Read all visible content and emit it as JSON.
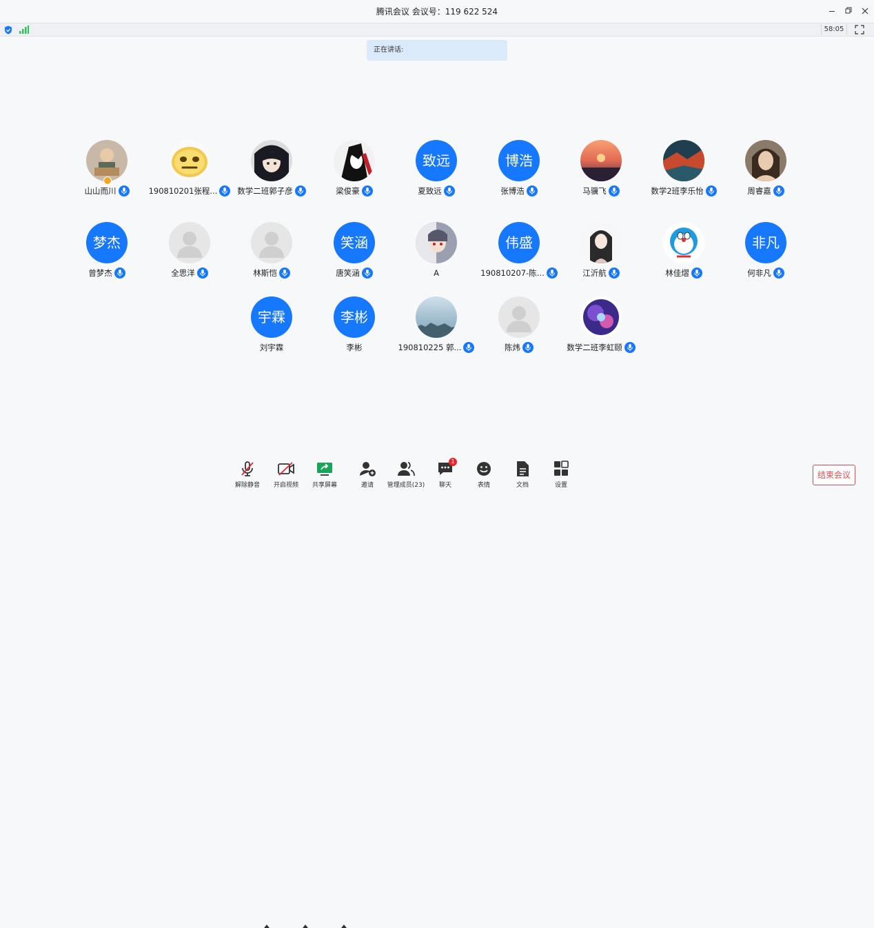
{
  "window": {
    "title": "腾讯会议 会议号：119 622 524",
    "controls": [
      "minimize-icon",
      "restore-icon",
      "close-icon"
    ]
  },
  "statusbar": {
    "timer": "58:05",
    "icons": [
      "shield-icon",
      "signal-icon",
      "fullscreen-icon"
    ]
  },
  "speaking": {
    "label": "正在讲话:"
  },
  "participants": [
    {
      "name": "山山而川",
      "type": "photo",
      "host": true
    },
    {
      "name": "190810201张程...",
      "type": "emoji"
    },
    {
      "name": "数学二班郭子彦",
      "type": "anime"
    },
    {
      "name": "梁俊豪",
      "type": "anime-dark"
    },
    {
      "name": "夏致远",
      "type": "text",
      "initials": "致远"
    },
    {
      "name": "张博浩",
      "type": "text",
      "initials": "博浩"
    },
    {
      "name": "马骥飞",
      "type": "sunset"
    },
    {
      "name": "数学2班李乐怡",
      "type": "landscape"
    },
    {
      "name": "周睿嘉",
      "type": "portrait"
    },
    {
      "name": "曾梦杰",
      "type": "text",
      "initials": "梦杰"
    },
    {
      "name": "全思洋",
      "type": "default"
    },
    {
      "name": "林斯恺",
      "type": "default"
    },
    {
      "name": "唐笑涵",
      "type": "text",
      "initials": "笑涵"
    },
    {
      "name": "A",
      "type": "anime-mix",
      "no_mic": true
    },
    {
      "name": "190810207-陈...",
      "type": "text",
      "initials": "伟盛"
    },
    {
      "name": "江沂航",
      "type": "anime-girl"
    },
    {
      "name": "林佳熠",
      "type": "doraemon"
    },
    {
      "name": "何非凡",
      "type": "text",
      "initials": "非凡"
    },
    {
      "name": "刘宇霖",
      "type": "text",
      "initials": "宇霖",
      "no_mic": true
    },
    {
      "name": "李彬",
      "type": "text",
      "initials": "李彬",
      "no_mic": true
    },
    {
      "name": "190810225 郭...",
      "type": "sky"
    },
    {
      "name": "陈炜",
      "type": "default"
    },
    {
      "name": "数学二班李虹颐",
      "type": "galaxy"
    }
  ],
  "toolbar": {
    "unmute": "解除静音",
    "start_video": "开启视频",
    "share_screen": "共享屏幕",
    "invite": "邀请",
    "manage_members": "管理成员(23)",
    "chat": "聊天",
    "chat_badge": "1",
    "reactions": "表情",
    "documents": "文档",
    "settings": "设置"
  },
  "end_meeting": "结束会议",
  "colors": {
    "accent": "#1677ff",
    "danger": "#e34d4d",
    "speaking_bg": "#dbeafa"
  }
}
